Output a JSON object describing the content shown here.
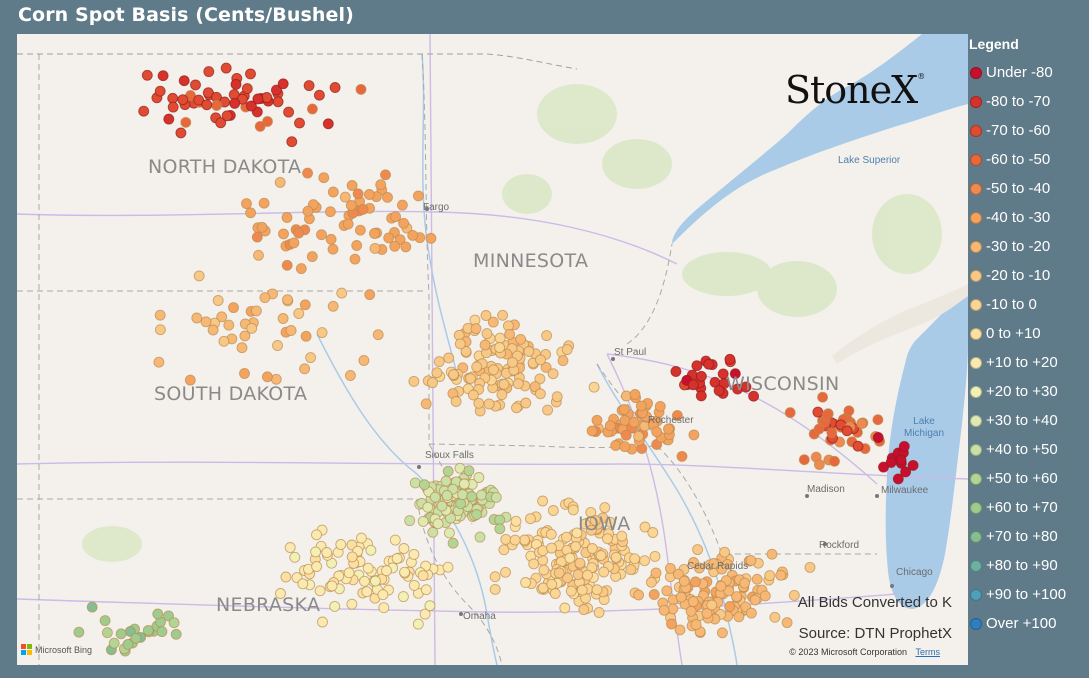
{
  "title": "Corn Spot Basis (Cents/Bushel)",
  "logo": {
    "text": "StoneX",
    "mark": "®"
  },
  "legend": {
    "title": "Legend",
    "items": [
      {
        "label": "Under -80",
        "color": "#c8102e"
      },
      {
        "label": "-80 to -70",
        "color": "#d7312b"
      },
      {
        "label": "-70 to -60",
        "color": "#e04b32"
      },
      {
        "label": "-60 to -50",
        "color": "#e8683d"
      },
      {
        "label": "-50 to -40",
        "color": "#ee8a4f"
      },
      {
        "label": "-40 to -30",
        "color": "#f3a35e"
      },
      {
        "label": "-30 to -20",
        "color": "#f6b874"
      },
      {
        "label": "-20 to -10",
        "color": "#f8c887"
      },
      {
        "label": "-10 to 0",
        "color": "#fad594"
      },
      {
        "label": "0 to +10",
        "color": "#fbe0a2"
      },
      {
        "label": "+10 to +20",
        "color": "#fbeab0"
      },
      {
        "label": "+20 to +30",
        "color": "#f1f0b5"
      },
      {
        "label": "+30 to +40",
        "color": "#dfeab2"
      },
      {
        "label": "+40 to +50",
        "color": "#c9e1a6"
      },
      {
        "label": "+50 to +60",
        "color": "#b2d596"
      },
      {
        "label": "+60 to +70",
        "color": "#9fcc8e"
      },
      {
        "label": "+70 to +80",
        "color": "#86bd91"
      },
      {
        "label": "+80 to +90",
        "color": "#6db0a3"
      },
      {
        "label": "+90 to +100",
        "color": "#4f9fb8"
      },
      {
        "label": "Over +100",
        "color": "#2d7fc0"
      }
    ]
  },
  "map": {
    "state_labels": [
      "NORTH DAKOTA",
      "MINNESOTA",
      "SOUTH DAKOTA",
      "WISCONSIN",
      "NEBRASKA",
      "IOWA"
    ],
    "city_labels": [
      "Fargo",
      "St Paul",
      "Rochester",
      "Sioux Falls",
      "Omaha",
      "Cedar Rapids",
      "Madison",
      "Milwaukee",
      "Rockford",
      "Chicago"
    ],
    "water_labels": [
      "Lake Superior",
      "Lake Michigan"
    ],
    "note_bids": "All Bids Converted to K",
    "note_source": "Source: DTN ProphetX",
    "attribution": "Microsoft Bing",
    "copyright": "© 2023 Microsoft Corporation",
    "terms": "Terms",
    "colors": {
      "land": "#f4f1ec",
      "water": "#a9cbe8",
      "forest": "#dbe8c8",
      "road": "#c9b8e4",
      "border": "#a7a7a7"
    }
  }
}
